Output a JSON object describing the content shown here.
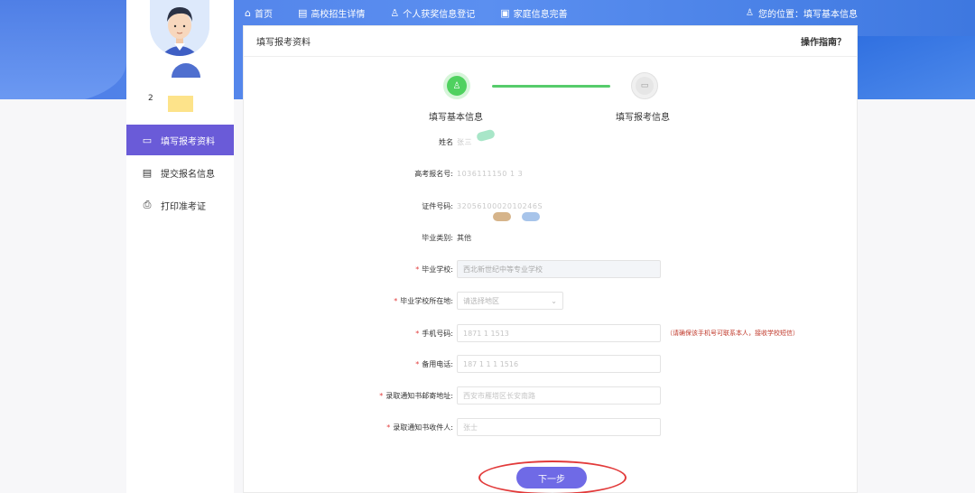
{
  "nav": {
    "items": [
      {
        "icon": "home-icon",
        "label": "首页"
      },
      {
        "icon": "document-icon",
        "label": "高校招生详情"
      },
      {
        "icon": "user-icon",
        "label": "个人获奖信息登记"
      },
      {
        "icon": "family-icon",
        "label": "家庭信息完善"
      }
    ],
    "location": "您的位置：填写基本信息"
  },
  "sidebar": {
    "number": "2",
    "menu": [
      {
        "icon": "id-card-icon",
        "label": "填写报考资料",
        "active": true
      },
      {
        "icon": "form-icon",
        "label": "提交报名信息",
        "active": false
      },
      {
        "icon": "printer-icon",
        "label": "打印准考证",
        "active": false
      }
    ]
  },
  "card": {
    "title": "填写报考资料",
    "help": "操作指南？"
  },
  "steps": {
    "step1": "填写基本信息",
    "step2": "填写报考信息"
  },
  "form": {
    "name_label": "姓名",
    "name_value": "张三",
    "exam_no_label": "高考报名号:",
    "exam_no_value": "1036111150 1 3",
    "id_label": "证件号码:",
    "id_value": "3205610002010246S",
    "grad_type_label": "毕业类别:",
    "grad_type_value": "其他",
    "school_label": "毕业学校:",
    "school_value": "西北新世纪中等专业学校",
    "school_area_label": "毕业学校所在地:",
    "school_area_placeholder": "请选择地区",
    "phone_label": "手机号码:",
    "phone_value": "1871 1 1513",
    "phone_hint": "（请确保该手机号可联系本人，接收学校短信）",
    "backup_phone_label": "备用电话:",
    "backup_phone_value": "187 1 1 1 1516",
    "address_label": "录取通知书邮寄地址:",
    "address_value": "西安市雁塔区长安南路",
    "receiver_label": "录取通知书收件人:",
    "receiver_value": "张士"
  },
  "buttons": {
    "next": "下一步"
  }
}
